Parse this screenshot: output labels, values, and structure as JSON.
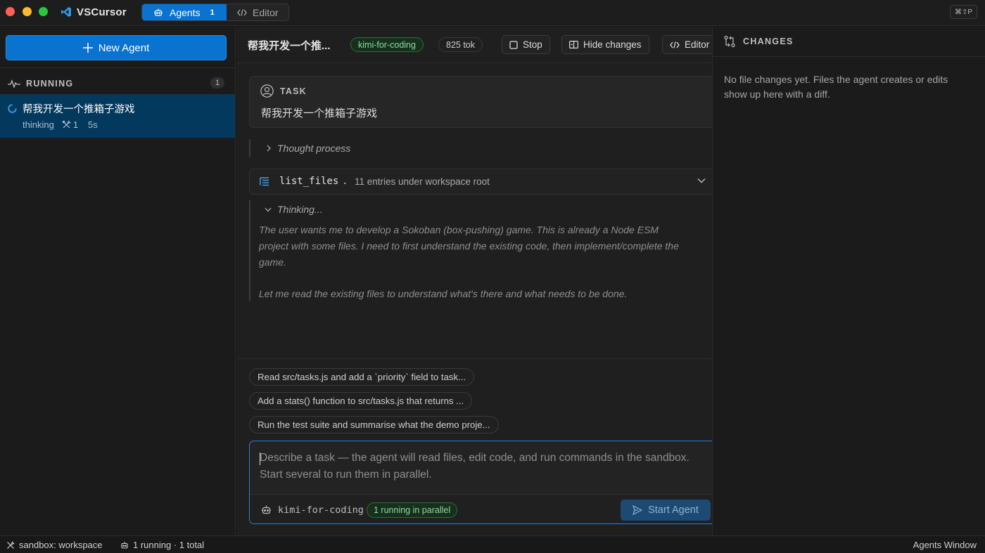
{
  "app": {
    "title": "VSCursor",
    "shortcut": "⌘⇧P"
  },
  "modes": {
    "agents_label": "Agents",
    "agents_count": "1",
    "editor_label": "Editor"
  },
  "sidebar": {
    "new_agent_label": "New Agent",
    "running_label": "RUNNING",
    "running_count": "1",
    "agents": [
      {
        "title": "帮我开发一个推箱子游戏",
        "status": "thinking",
        "tools": "1",
        "elapsed": "5s"
      }
    ]
  },
  "main": {
    "heading": "帮我开发一个推...",
    "model": "kimi-for-coding",
    "tokens": "825 tok",
    "stop_label": "Stop",
    "hide_changes_label": "Hide changes",
    "editor_label": "Editor",
    "task": {
      "label": "TASK",
      "text": "帮我开发一个推箱子游戏"
    },
    "thought_process_label": "Thought process",
    "tool_call": {
      "name": "list_files",
      "arg": ".",
      "summary": "11 entries under workspace root"
    },
    "thinking": {
      "label": "Thinking...",
      "lines": [
        "The user wants me to develop a Sokoban (box-pushing) game. This is already a Node ESM",
        "project with some files. I need to first understand the existing code, then implement/complete the",
        "game.",
        "Let me read the existing files to understand what's there and what needs to be done."
      ]
    },
    "suggestions": [
      "Read src/tasks.js and add a `priority` field to task...",
      "Add a stats() function to src/tasks.js that returns ...",
      "Run the test suite and summarise what the demo proje..."
    ],
    "composer": {
      "placeholder_line1": "Describe a task — the agent will read files, edit code, and run commands in the sandbox.",
      "placeholder_line2": "Start several to run them in parallel.",
      "model": "kimi-for-coding",
      "parallel_status": "1 running in parallel",
      "start_label": "Start Agent"
    }
  },
  "changes": {
    "title": "CHANGES",
    "empty_text": "No file changes yet. Files the agent creates or edits show up here with a diff."
  },
  "statusbar": {
    "sandbox": "sandbox: workspace",
    "running": "1 running · 1 total",
    "window": "Agents Window"
  },
  "colors": {
    "accent": "#0a72cf",
    "selection": "#04395e",
    "success": "#8fd79d",
    "close": "#ff5f57",
    "minimize": "#febc2e",
    "maximize": "#28c840"
  }
}
